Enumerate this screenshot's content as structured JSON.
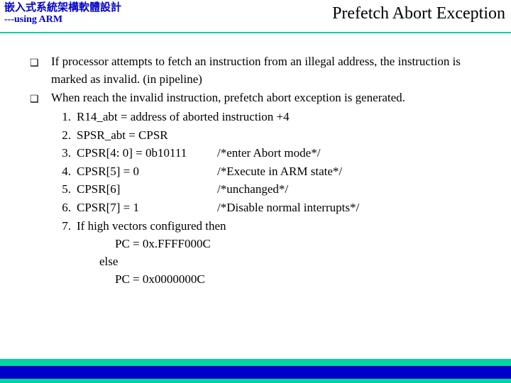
{
  "header": {
    "title_cjk": "嵌入式系統架構軟體設計",
    "subtitle": "---using ARM",
    "page_title": "Prefetch Abort Exception"
  },
  "bullets": [
    "If processor attempts to fetch an instruction from an illegal address, the instruction is marked as invalid. (in pipeline)",
    "When reach the invalid instruction, prefetch abort exception is generated."
  ],
  "steps": [
    {
      "n": "1.",
      "lhs": "R14_abt = address of aborted instruction +4",
      "rhs": ""
    },
    {
      "n": "2.",
      "lhs": "SPSR_abt = CPSR",
      "rhs": ""
    },
    {
      "n": "3.",
      "lhs": "CPSR[4: 0] = 0b10111",
      "rhs": "/*enter Abort mode*/"
    },
    {
      "n": "4.",
      "lhs": "CPSR[5] = 0",
      "rhs": "/*Execute in ARM state*/"
    },
    {
      "n": "5.",
      "lhs": "CPSR[6]",
      "rhs": "/*unchanged*/"
    },
    {
      "n": "6.",
      "lhs": "CPSR[7] = 1",
      "rhs": "/*Disable normal interrupts*/"
    },
    {
      "n": "7.",
      "lhs": "If high vectors configured then",
      "rhs": ""
    }
  ],
  "cond": {
    "then_pc": "PC = 0x.FFFF000C",
    "else_kw": "else",
    "else_pc": "PC = 0x0000000C"
  }
}
